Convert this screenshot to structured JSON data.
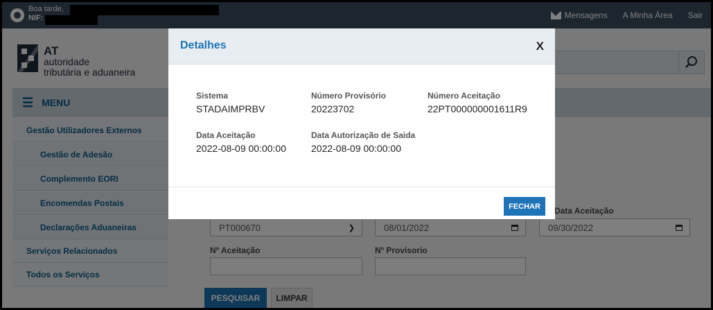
{
  "topbar": {
    "greeting": "Boa tarde,",
    "nif_label": "NIF:",
    "messages": "Mensagens",
    "my_area": "A Minha Área",
    "logout": "Sair"
  },
  "logo": {
    "abbr": "AT",
    "line1": "autoridade",
    "line2": "tributária e aduaneira"
  },
  "sidebar": {
    "menu_label": "MENU",
    "items": [
      {
        "label": "Gestão Utilizadores Externos"
      },
      {
        "label": "Gestão de Adesão"
      },
      {
        "label": "Complemento EORI"
      },
      {
        "label": "Encomendas Postais"
      },
      {
        "label": "Declarações Aduaneiras"
      },
      {
        "label": "Serviços Relacionados"
      },
      {
        "label": "Todos os Serviços"
      }
    ]
  },
  "form": {
    "select_value": "PT000670",
    "date_from": "08/01/2022",
    "data_aceitacao_label": "Data Aceitação",
    "date_to": "09/30/2022",
    "n_aceitacao_label": "Nº Aceitação",
    "n_provisorio_label": "Nº Provisorio",
    "search_button": "PESQUISAR",
    "clear_button": "LIMPAR"
  },
  "modal": {
    "title": "Detalhes",
    "close": "X",
    "fields": [
      {
        "label": "Sistema",
        "value": "STADAIMPRBV"
      },
      {
        "label": "Número Provisório",
        "value": "20223702"
      },
      {
        "label": "Número Aceitação",
        "value": "22PT000000001611R9"
      },
      {
        "label": "Data Aceitação",
        "value": "2022-08-09 00:00:00"
      },
      {
        "label": "Data Autorização de Saida",
        "value": "2022-08-09 00:00:00"
      }
    ],
    "close_button": "FECHAR"
  },
  "colors": {
    "topbar": "#3b4a5e",
    "accent": "#1f73b7",
    "sidebar_text": "#0c5a86"
  },
  "icons": {
    "avatar": "user-avatar-icon",
    "messages": "envelope-icon",
    "menu": "hamburger-icon",
    "search": "search-icon",
    "calendar": "calendar-icon",
    "dropdown": "chevron-down-icon"
  }
}
